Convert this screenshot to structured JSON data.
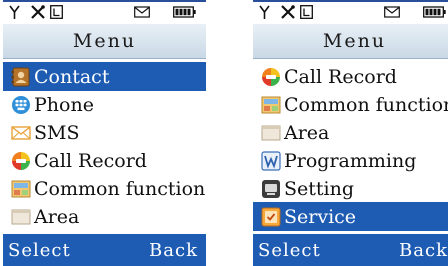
{
  "screens": [
    {
      "title": "Menu",
      "items": [
        {
          "label": "Contact",
          "icon": "contact-book-icon",
          "selected": true
        },
        {
          "label": "Phone",
          "icon": "phone-icon",
          "selected": false
        },
        {
          "label": "SMS",
          "icon": "envelope-icon",
          "selected": false
        },
        {
          "label": "Call Record",
          "icon": "call-record-icon",
          "selected": false
        },
        {
          "label": "Common function",
          "icon": "common-function-icon",
          "selected": false
        },
        {
          "label": "Area",
          "icon": "area-icon",
          "selected": false
        }
      ],
      "softkeys": {
        "left": "Select",
        "right": "Back"
      }
    },
    {
      "title": "Menu",
      "items": [
        {
          "label": "Call Record",
          "icon": "call-record-icon",
          "selected": false
        },
        {
          "label": "Common function",
          "icon": "common-function-icon",
          "selected": false
        },
        {
          "label": "Area",
          "icon": "area-icon",
          "selected": false
        },
        {
          "label": "Programming",
          "icon": "programming-icon",
          "selected": false
        },
        {
          "label": "Setting",
          "icon": "setting-icon",
          "selected": false
        },
        {
          "label": "Service",
          "icon": "service-icon",
          "selected": true
        }
      ],
      "softkeys": {
        "left": "Select",
        "right": "Back"
      }
    }
  ],
  "colors": {
    "highlight": "#1e5cb3",
    "title_bar": "#d6e3ef",
    "softkey_bar": "#1e5cb3"
  }
}
